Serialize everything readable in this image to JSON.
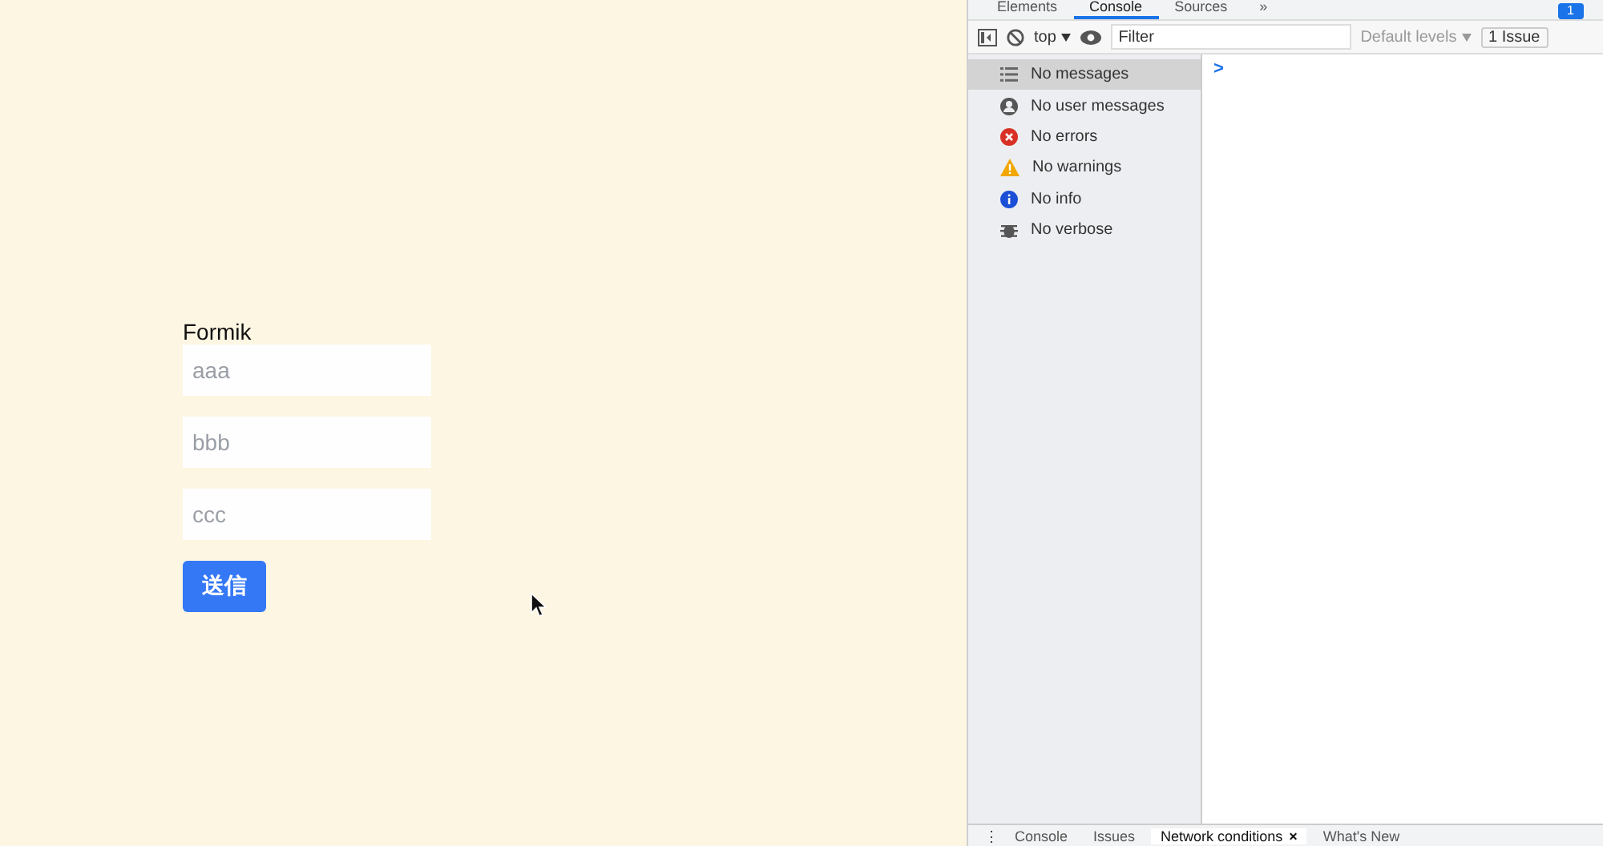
{
  "page": {
    "form_title": "Formik",
    "fields": [
      {
        "placeholder": "aaa"
      },
      {
        "placeholder": "bbb"
      },
      {
        "placeholder": "ccc"
      }
    ],
    "submit": "送信"
  },
  "devtools": {
    "tabs": [
      {
        "label": "Elements",
        "selected": false
      },
      {
        "label": "Console",
        "selected": true
      },
      {
        "label": "Sources",
        "selected": false
      },
      {
        "label": "»",
        "selected": false
      }
    ],
    "issues_badge": "1",
    "toolbar": {
      "context": "top",
      "filter_placeholder": "Filter",
      "levels": "Default levels",
      "issues": "1 Issue"
    },
    "sidebar": [
      {
        "kind": "list",
        "label": "No messages",
        "selected": true
      },
      {
        "kind": "user",
        "label": "No user messages",
        "selected": false
      },
      {
        "kind": "error",
        "label": "No errors",
        "selected": false
      },
      {
        "kind": "warning",
        "label": "No warnings",
        "selected": false
      },
      {
        "kind": "info",
        "label": "No info",
        "selected": false
      },
      {
        "kind": "verbose",
        "label": "No verbose",
        "selected": false
      }
    ],
    "prompt": ">",
    "drawer": {
      "menu": "⋮",
      "tabs": [
        {
          "label": "Console",
          "selected": false,
          "closable": false
        },
        {
          "label": "Issues",
          "selected": false,
          "closable": false
        },
        {
          "label": "Network conditions",
          "selected": true,
          "closable": true
        },
        {
          "label": "What's New",
          "selected": false,
          "closable": false
        }
      ],
      "close": "×"
    }
  }
}
